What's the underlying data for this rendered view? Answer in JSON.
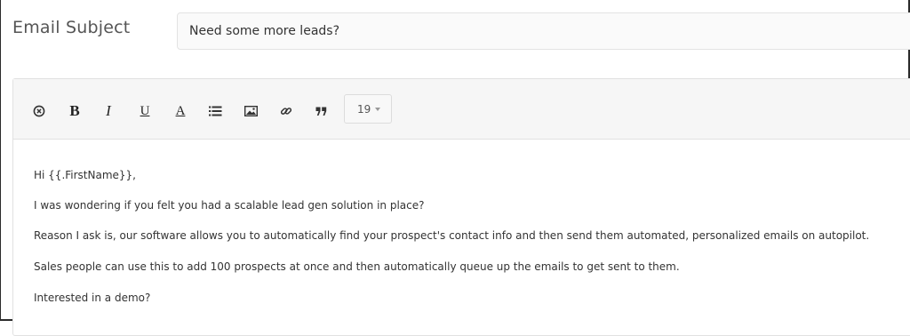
{
  "subject": {
    "label": "Email Subject",
    "value": "Need some more leads?"
  },
  "toolbar": {
    "buttons": [
      {
        "name": "clear-format-button",
        "icon": "clear-format-icon"
      },
      {
        "name": "bold-button",
        "icon": "bold-icon",
        "glyph": "B"
      },
      {
        "name": "italic-button",
        "icon": "italic-icon",
        "glyph": "I"
      },
      {
        "name": "underline-button",
        "icon": "underline-icon",
        "glyph": "U"
      },
      {
        "name": "text-color-button",
        "icon": "text-color-icon",
        "glyph": "A"
      },
      {
        "name": "list-button",
        "icon": "list-icon"
      },
      {
        "name": "image-button",
        "icon": "image-icon"
      },
      {
        "name": "link-button",
        "icon": "link-icon"
      },
      {
        "name": "quote-button",
        "icon": "quote-icon"
      }
    ],
    "font_size": "19"
  },
  "body": {
    "lines": [
      "Hi {{.FirstName}},",
      "I was wondering if you felt you had a scalable lead gen solution in place?",
      "Reason I ask is, our software allows you to automatically find your prospect's contact info and then send them automated, personalized emails on autopilot.",
      "Sales people can use this to add 100 prospects at once and then automatically queue up the emails to get sent to them.",
      "Interested in a demo?"
    ]
  }
}
